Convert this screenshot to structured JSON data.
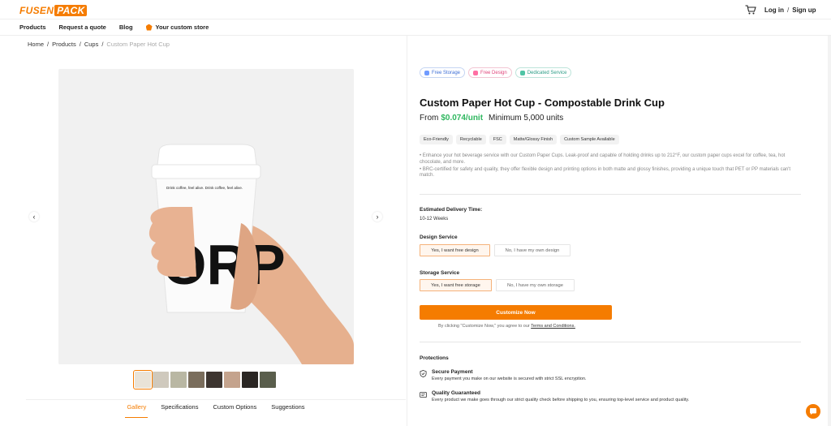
{
  "header": {
    "logo_left": "FUSEN",
    "logo_right": "PACK",
    "login": "Log in",
    "separator": "/",
    "signup": "Sign up",
    "cart_icon": "cart-icon"
  },
  "nav": {
    "items": [
      "Products",
      "Request a quote",
      "Blog"
    ],
    "store_label": "Your custom store"
  },
  "breadcrumb": {
    "items": [
      "Home",
      "Products",
      "Cups"
    ],
    "separator": "/",
    "current": "Custom Paper Hot Cup"
  },
  "product_image": {
    "cup_text": "Drink coffee, feel alive. Drink coffee, feel alive.",
    "cup_print": "ORP"
  },
  "gallery": {
    "thumb_colors": [
      "#e9e3d8",
      "#cfc9bd",
      "#b9b7a3",
      "#7a6d5c",
      "#3d3530",
      "#c4a38d",
      "#2a2623",
      "#5a5e4c"
    ]
  },
  "tabs": [
    "Gallery",
    "Specifications",
    "Custom Options",
    "Suggestions"
  ],
  "badges": [
    "Free Storage",
    "Free Design",
    "Dedicated Service"
  ],
  "product": {
    "title": "Custom Paper Hot Cup - Compostable Drink Cup",
    "from": "From",
    "price": "$0.074/unit",
    "minimum": "Minimum 5,000 units"
  },
  "features": [
    "Eco-Friendly",
    "Recyclable",
    "FSC",
    "Matte/Glossy Finish",
    "Custom Sample Available"
  ],
  "description": [
    "• Enhance your hot beverage service with our Custom Paper Cups. Leak-proof and capable of holding drinks up to 212°F, our custom paper cups excel for coffee, tea, hot chocolate, and more.",
    "• BRC-certified for safety and quality, they offer flexible design and printing options in both matte and glossy finishes, providing a unique touch that PET or PP materials can't match."
  ],
  "delivery": {
    "label": "Estimated Delivery Time:",
    "value": "10-12 Weeks"
  },
  "design_service": {
    "label": "Design Service",
    "options": [
      "Yes, I want free design",
      "No, I have my own design"
    ]
  },
  "storage_service": {
    "label": "Storage Service",
    "options": [
      "Yes, I want free storage",
      "No, I have my own storage"
    ]
  },
  "cta": {
    "label": "Customize Now",
    "terms_prefix": "By clicking \"Customize Now,\" you agree to our",
    "terms_link": "Terms and Conditions."
  },
  "protections": {
    "label": "Protections",
    "items": [
      {
        "title": "Secure Payment",
        "desc": "Every payment you make on our website is secured with strict SSL encryption.",
        "icon": "shield-icon"
      },
      {
        "title": "Quality Guaranteed",
        "desc": "Every product we make goes through our strict quality check before shipping to you, ensuring top-level service and product quality.",
        "icon": "badge-icon"
      }
    ]
  },
  "colors": {
    "accent": "#f57c00",
    "price": "#2fb75f"
  }
}
